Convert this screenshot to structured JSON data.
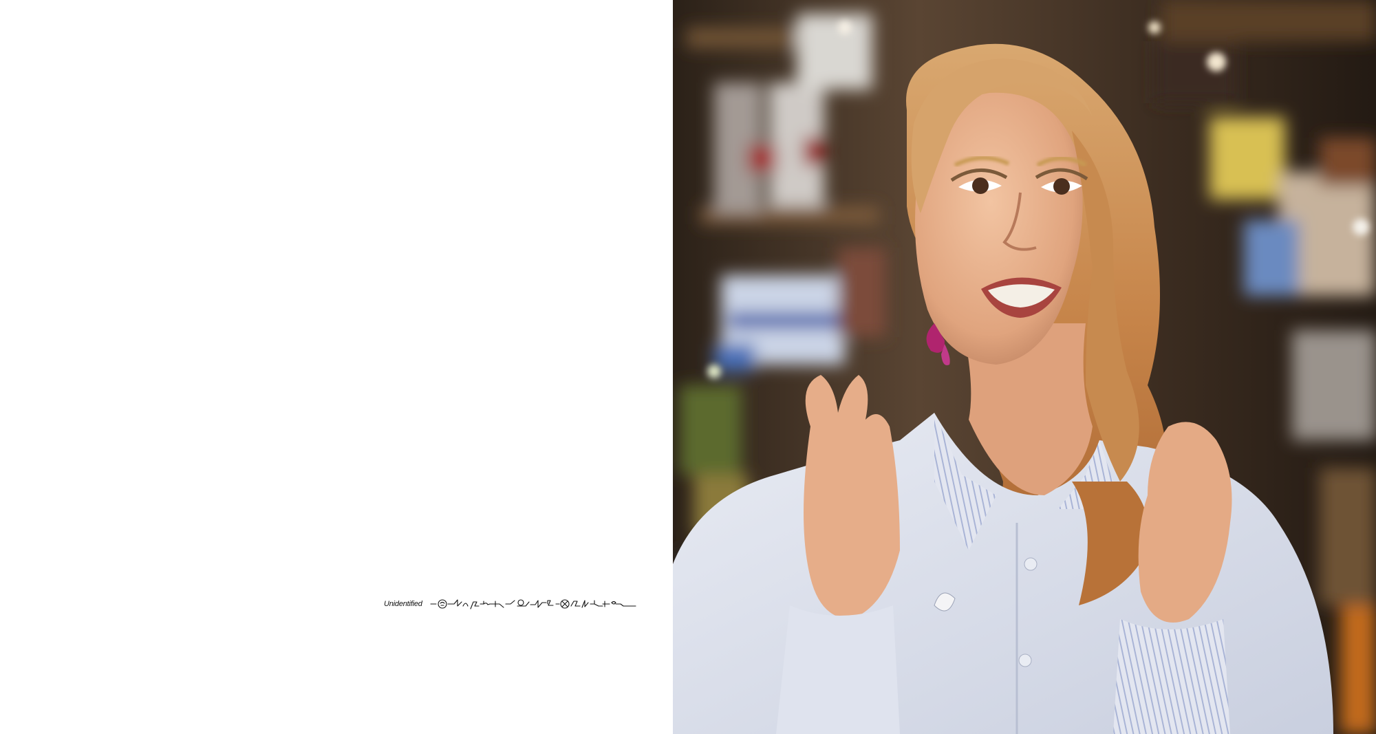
{
  "left_page": {
    "caption_label": "Unidentified",
    "script_icon": "handwritten-glyph-signature"
  },
  "right_page": {
    "photo_subject": "woman-grinning-in-shop-photo",
    "colors": {
      "background_bokeh": "#3a2a1e",
      "hair": "#c98b52",
      "shirt": "#dfe3ee",
      "skin": "#e9b592"
    }
  }
}
